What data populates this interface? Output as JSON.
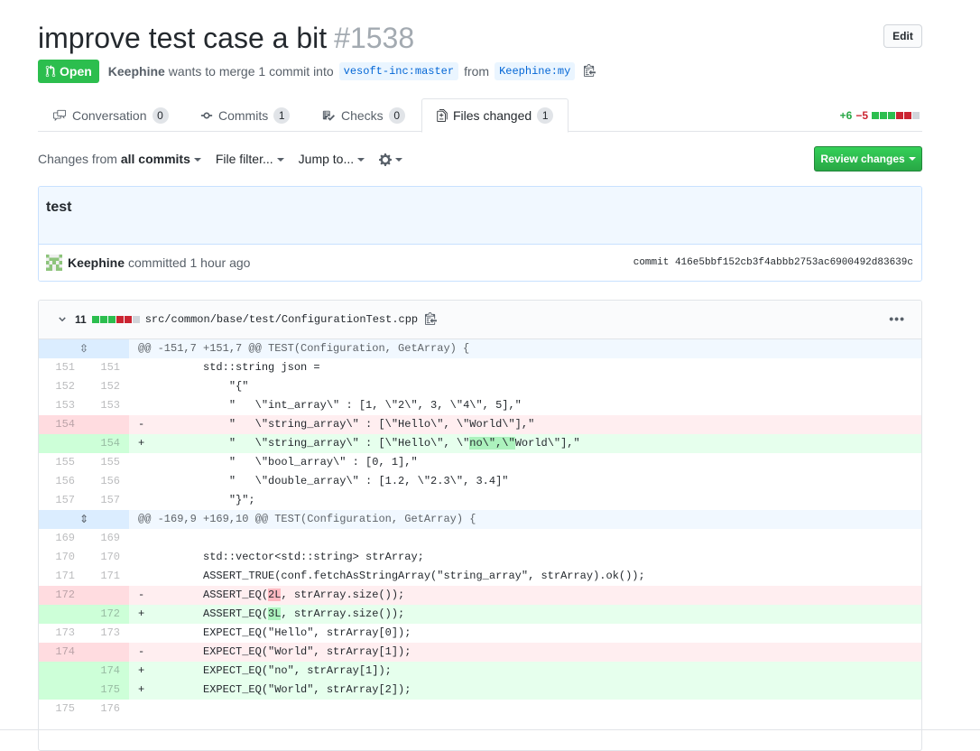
{
  "pr": {
    "title": "improve test case a bit",
    "number": "#1538",
    "edit_label": "Edit",
    "state_label": "Open",
    "author": "Keephine",
    "merge_text": "wants to merge 1 commit into",
    "base_branch": "vesoft-inc:master",
    "from_text": "from",
    "head_branch": "Keephine:my"
  },
  "tabs": [
    {
      "label": "Conversation",
      "count": "0"
    },
    {
      "label": "Commits",
      "count": "1"
    },
    {
      "label": "Checks",
      "count": "0"
    },
    {
      "label": "Files changed",
      "count": "1"
    }
  ],
  "diffstat": {
    "added": "+6",
    "removed": "−5"
  },
  "toolbar": {
    "changes_from": "Changes from",
    "all_commits": "all commits",
    "file_filter": "File filter...",
    "jump_to": "Jump to...",
    "review_label": "Review changes"
  },
  "commit": {
    "message": "test",
    "author": "Keephine",
    "action": "committed 1 hour ago",
    "sha": "commit 416e5bbf152cb3f4abbb2753ac6900492d83639c"
  },
  "file": {
    "count": "11",
    "path": "src/common/base/test/ConfigurationTest.cpp"
  },
  "diff": {
    "hunk1": "@@ -151,7 +151,7 @@ TEST(Configuration, GetArray) {",
    "hunk2": "@@ -169,9 +169,10 @@ TEST(Configuration, GetArray) {",
    "lines": [
      {
        "old": "151",
        "new": "151",
        "sign": " ",
        "text": "        std::string json ="
      },
      {
        "old": "152",
        "new": "152",
        "sign": " ",
        "text": "            \"{\""
      },
      {
        "old": "153",
        "new": "153",
        "sign": " ",
        "text": "            \"   \\\"int_array\\\" : [1, \\\"2\\\", 3, \\\"4\\\", 5],\""
      },
      {
        "old": "154",
        "new": "",
        "sign": "-",
        "text": "            \"   \\\"string_array\\\" : [\\\"Hello\\\", \\\"World\\\"],\""
      },
      {
        "old": "",
        "new": "154",
        "sign": "+",
        "pre": "            \"   \\\"string_array\\\" : [\\\"Hello\\\", \\\"",
        "hl": "no\\\",\\\"",
        "post": "World\\\"],\""
      },
      {
        "old": "155",
        "new": "155",
        "sign": " ",
        "text": "            \"   \\\"bool_array\\\" : [0, 1],\""
      },
      {
        "old": "156",
        "new": "156",
        "sign": " ",
        "text": "            \"   \\\"double_array\\\" : [1.2, \\\"2.3\\\", 3.4]\""
      },
      {
        "old": "157",
        "new": "157",
        "sign": " ",
        "text": "            \"}\";"
      },
      {
        "old": "169",
        "new": "169",
        "sign": " ",
        "text": ""
      },
      {
        "old": "170",
        "new": "170",
        "sign": " ",
        "text": "        std::vector<std::string> strArray;"
      },
      {
        "old": "171",
        "new": "171",
        "sign": " ",
        "text": "        ASSERT_TRUE(conf.fetchAsStringArray(\"string_array\", strArray).ok());"
      },
      {
        "old": "172",
        "new": "",
        "sign": "-",
        "pre": "        ASSERT_EQ(",
        "hl": "2L",
        "post": ", strArray.size());"
      },
      {
        "old": "",
        "new": "172",
        "sign": "+",
        "pre": "        ASSERT_EQ(",
        "hl": "3L",
        "post": ", strArray.size());"
      },
      {
        "old": "173",
        "new": "173",
        "sign": " ",
        "text": "        EXPECT_EQ(\"Hello\", strArray[0]);"
      },
      {
        "old": "174",
        "new": "",
        "sign": "-",
        "text": "        EXPECT_EQ(\"World\", strArray[1]);"
      },
      {
        "old": "",
        "new": "174",
        "sign": "+",
        "text": "        EXPECT_EQ(\"no\", strArray[1]);"
      },
      {
        "old": "",
        "new": "175",
        "sign": "+",
        "text": "        EXPECT_EQ(\"World\", strArray[2]);"
      },
      {
        "old": "175",
        "new": "176",
        "sign": " ",
        "text": ""
      }
    ]
  },
  "colors": {
    "open_green": "#2cbe4e",
    "link_blue": "#0366d6",
    "add_bg": "#e6ffed",
    "del_bg": "#ffeef0"
  }
}
